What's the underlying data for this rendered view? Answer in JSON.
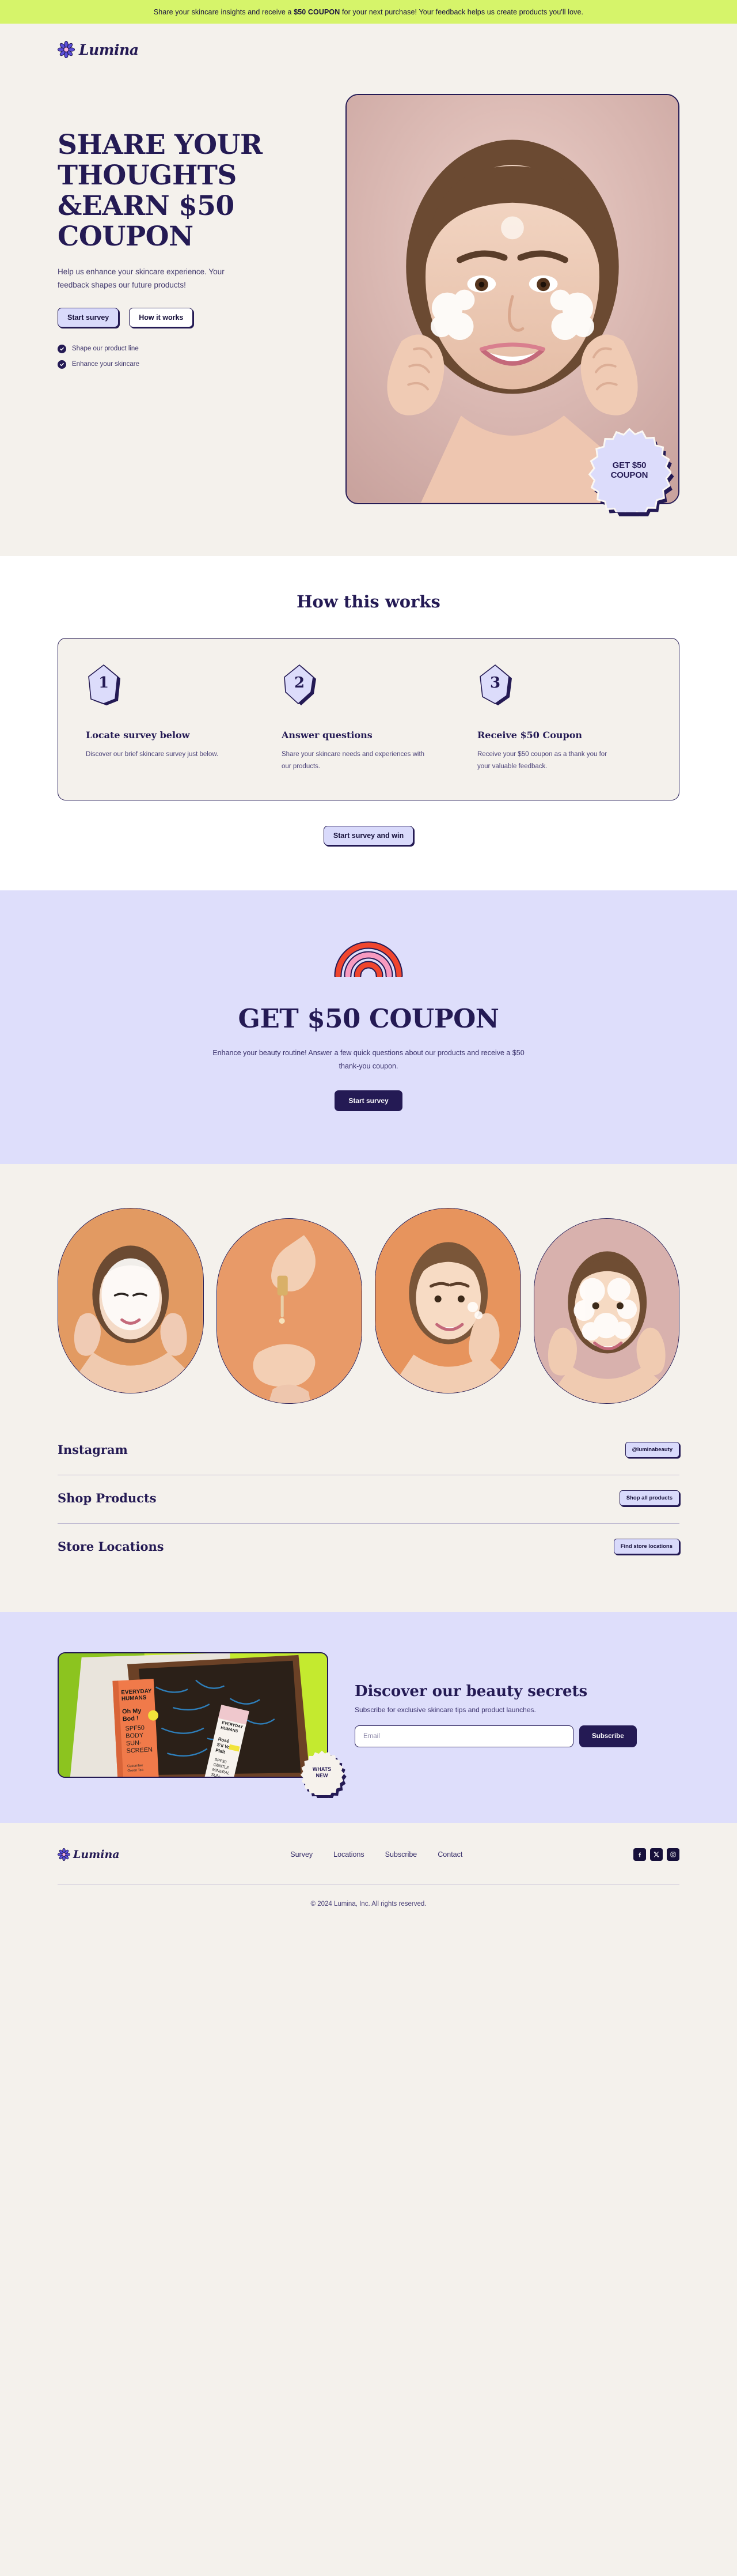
{
  "announcement": {
    "pre": "Share your skincare insights and receive a ",
    "bold": "$50 COUPON",
    "post": " for your next purchase! Your feedback helps us create products you'll love."
  },
  "header": {
    "brand": "Lumina",
    "logo_icon": "flower-icon"
  },
  "hero": {
    "title": "SHARE YOUR THOUGHTS &EARN $50 COUPON",
    "subtitle": "Help us enhance your skincare experience. Your feedback shapes our future products!",
    "primary_button": "Start survey",
    "secondary_button": "How it works",
    "checks": [
      "Shape our product line",
      "Enhance your skincare"
    ],
    "badge_line1": "GET $50",
    "badge_line2": "COUPON",
    "image_alt": "woman-applying-facial-cleanser"
  },
  "how": {
    "title": "How this works",
    "steps": [
      {
        "num": "1",
        "title": "Locate survey below",
        "desc": "Discover our brief skincare survey just below."
      },
      {
        "num": "2",
        "title": "Answer questions",
        "desc": "Share your skincare needs and experiences with our products."
      },
      {
        "num": "3",
        "title": "Receive $50 Coupon",
        "desc": "Receive your $50 coupon as a thank you for your valuable feedback."
      }
    ],
    "cta": "Start survey and win"
  },
  "band": {
    "icon": "rainbow-icon",
    "title": "GET $50 COUPON",
    "subtitle": "Enhance your beauty routine! Answer a few quick questions about our products and receive a $50 thank-you coupon.",
    "button": "Start survey"
  },
  "gallery": {
    "items": [
      {
        "alt": "woman-with-cream-mask"
      },
      {
        "alt": "hand-holding-serum-dropper"
      },
      {
        "alt": "woman-applying-moisturizer"
      },
      {
        "alt": "woman-with-foam-cleanser"
      }
    ]
  },
  "link_rows": [
    {
      "title": "Instagram",
      "action": "@luminabeauty"
    },
    {
      "title": "Shop Products",
      "action": "Shop all products"
    },
    {
      "title": "Store Locations",
      "action": "Find store locations"
    }
  ],
  "newsletter": {
    "image_alt": "sunscreen-product-box",
    "badge_line1": "WHATS",
    "badge_line2": "NEW",
    "title": "Discover our beauty secrets",
    "subtitle": "Subscribe for exclusive skincare tips and product launches.",
    "input_placeholder": "Email",
    "input_value": "",
    "button": "Subscribe"
  },
  "footer": {
    "brand": "Lumina",
    "nav": [
      "Survey",
      "Locations",
      "Subscribe",
      "Contact"
    ],
    "social": [
      "facebook-icon",
      "x-icon",
      "instagram-icon"
    ],
    "copyright": "© 2024 Lumina, Inc. All rights reserved."
  },
  "colors": {
    "cream": "#f4f1ec",
    "lime": "#d6f46a",
    "navy": "#241a54",
    "lavender": "#dedefb",
    "lavender_light": "#d9dafb"
  }
}
